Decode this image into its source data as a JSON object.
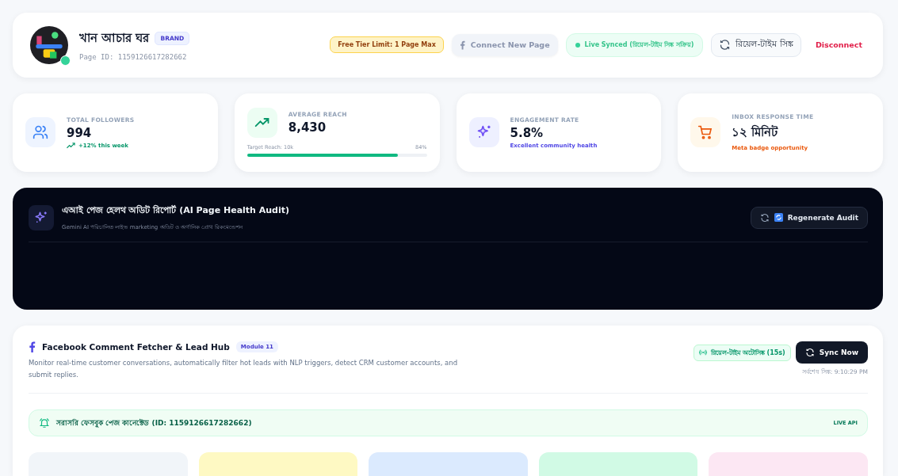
{
  "page": {
    "name": "খান আচার ঘর",
    "badge": "BRAND",
    "page_id": "Page ID: 1159126617282662",
    "online": true
  },
  "header_actions": {
    "limit": "Free Tier Limit: 1 Page Max",
    "connect": "Connect New Page",
    "synced": "Live Synced (রিয়েল-টাইম সিঙ্ক সক্রিয়)",
    "sync": "রিয়েল-টাইম সিঙ্ক",
    "disconnect": "Disconnect"
  },
  "stats": [
    {
      "kind": "trend",
      "label": "TOTAL FOLLOWERS",
      "value": "994",
      "note": "+12% this week",
      "color": "#059669"
    },
    {
      "kind": "progress",
      "label": "AVERAGE REACH",
      "value": "8,430",
      "target": "Target Reach: 10k",
      "percent": "84%",
      "level": 0.84
    },
    {
      "kind": "note",
      "label": "ENGAGEMENT RATE",
      "value": "5.8%",
      "note": "Excellent community health",
      "color": "#4f46e5"
    },
    {
      "kind": "note",
      "label": "INBOX RESPONSE TIME",
      "value": "১২ মিনিট",
      "note": "Meta badge opportunity",
      "color": "#ea580c"
    }
  ],
  "audit": {
    "title": "এআই পেজ হেলথ অডিট রিপোর্ট (AI Page Health Audit)",
    "subtitle": "Gemini AI পরিচালিত লাইভ marketing অডিট ও অর্গানিক গ্রোথ রিকমেন্ডেশন",
    "button": "Regenerate Audit"
  },
  "module": {
    "title": "Facebook Comment Fetcher & Lead Hub",
    "badge": "Module 11",
    "description": "Monitor real-time customer conversations, automatically filter hot leads with NLP triggers, detect CRM customer accounts, and submit replies.",
    "autosync": "রিয়েল-টাইম অটোসিঙ্ক (15s)",
    "sync_button": "Sync Now",
    "last_sync": "সর্বশেষ সিঙ্ক: 9:10:29 PM",
    "connection": "সরাসরি ফেসবুক পেজ কানেক্টেড (ID: 1159126617282662)",
    "connection_badge": "LIVE API",
    "cards": [
      {
        "color": "#f1f5f9"
      },
      {
        "color": "#fef9c3"
      },
      {
        "color": "#dbeafe"
      },
      {
        "color": "#d1fae5"
      },
      {
        "color": "#fce7f3"
      }
    ]
  }
}
